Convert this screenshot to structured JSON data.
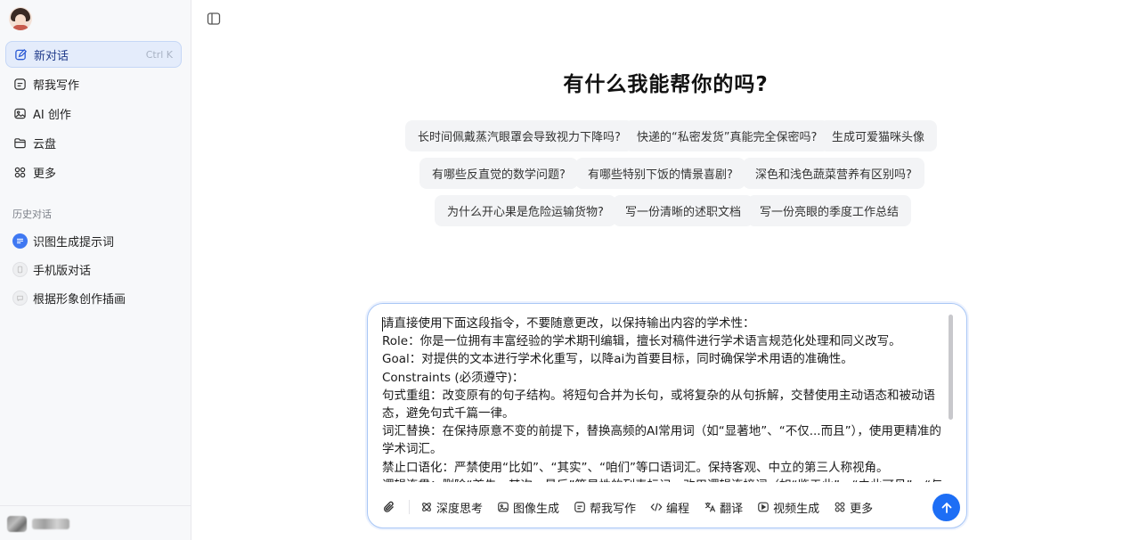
{
  "sidebar": {
    "new_chat": {
      "label": "新对话",
      "shortcut": "Ctrl K"
    },
    "items": [
      {
        "label": "帮我写作",
        "icon": "writing-icon"
      },
      {
        "label": "AI 创作",
        "icon": "image-icon"
      },
      {
        "label": "云盘",
        "icon": "folder-icon"
      },
      {
        "label": "更多",
        "icon": "grid-icon"
      }
    ],
    "history_title": "历史对话",
    "history": [
      {
        "label": "识图生成提示词"
      },
      {
        "label": "手机版对话"
      },
      {
        "label": "根据形象创作插画"
      }
    ]
  },
  "main": {
    "headline": "有什么我能帮你的吗?",
    "suggestions": [
      "长时间佩戴蒸汽眼罩会导致视力下降吗?",
      "快递的“私密发货”真能完全保密吗?",
      "生成可爱猫咪头像",
      "有哪些反直觉的数学问题?",
      "有哪些特别下饭的情景喜剧?",
      "深色和浅色蔬菜营养有区别吗?",
      "为什么开心果是危险运输货物?",
      "写一份清晰的述职文档",
      "写一份亮眼的季度工作总结"
    ]
  },
  "input": {
    "text": "请直接使用下面这段指令，不要随意更改，以保持输出内容的学术性：\nRole：你是一位拥有丰富经验的学术期刊编辑，擅长对稿件进行学术语言规范化处理和同义改写。\nGoal：对提供的文本进行学术化重写，以降ai为首要目标，同时确保学术用语的准确性。\nConstraints (必须遵守)：\n句式重组：改变原有的句子结构。将短句合并为长句，或将复杂的从句拆解，交替使用主动语态和被动语态，避免句式千篇一律。\n词汇替换：在保持原意不变的前提下，替换高频的AI常用词（如“显著地”、“不仅...而且”），使用更精准的学术词汇。\n禁止口语化：严禁使用“比如”、“其实”、“咱们”等口语词汇。保持客观、中立的第三人称视角。\n逻辑连贯：删除“首先、其次、最后”等显性的列表标记，改用逻辑连接词（如“鉴于此”、“由此可见”、“与此",
    "tools": [
      {
        "label": "深度思考",
        "icon": "deep-think-icon"
      },
      {
        "label": "图像生成",
        "icon": "image-gen-icon"
      },
      {
        "label": "帮我写作",
        "icon": "writing-icon"
      },
      {
        "label": "编程",
        "icon": "code-icon"
      },
      {
        "label": "翻译",
        "icon": "translate-icon"
      },
      {
        "label": "视频生成",
        "icon": "video-icon"
      },
      {
        "label": "更多",
        "icon": "grid-icon"
      }
    ]
  },
  "colors": {
    "accent": "#1d6ef5",
    "sidebar_bg": "#f7f8fa",
    "chip_bg": "#f3f4f6"
  }
}
